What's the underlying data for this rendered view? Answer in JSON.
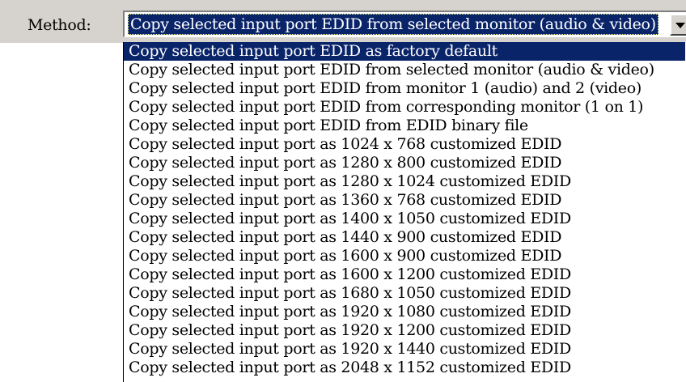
{
  "method": {
    "label": "Method:",
    "selected_value": "Copy selected input port EDID from selected monitor (audio & video)",
    "highlighted_index": 0,
    "options": [
      "Copy selected input port EDID as factory default",
      "Copy selected input port EDID from selected monitor (audio & video)",
      "Copy selected input port EDID from monitor 1 (audio) and 2 (video)",
      "Copy selected input port EDID from corresponding monitor (1 on 1)",
      "Copy selected input port EDID from EDID binary file",
      "Copy selected input port as 1024 x  768 customized EDID",
      "Copy selected input port as 1280 x  800 customized EDID",
      "Copy selected input port as 1280 x 1024 customized EDID",
      "Copy selected input port as 1360 x  768 customized EDID",
      "Copy selected input port as 1400 x 1050 customized EDID",
      "Copy selected input port as 1440 x  900 customized EDID",
      "Copy selected input port as 1600 x  900 customized EDID",
      "Copy selected input port as 1600 x 1200 customized EDID",
      "Copy selected input port as 1680 x 1050 customized EDID",
      "Copy selected input port as 1920 x 1080 customized EDID",
      "Copy selected input port as 1920 x 1200 customized EDID",
      "Copy selected input port as 1920 x 1440 customized EDID",
      "Copy selected input port as 2048 x 1152 customized EDID"
    ]
  },
  "icons": {
    "dropdown_arrow": "chevron-down-icon"
  },
  "colors": {
    "highlight": "#0a246a",
    "highlight_text": "#ffffff",
    "panel": "#d6d3ce"
  }
}
